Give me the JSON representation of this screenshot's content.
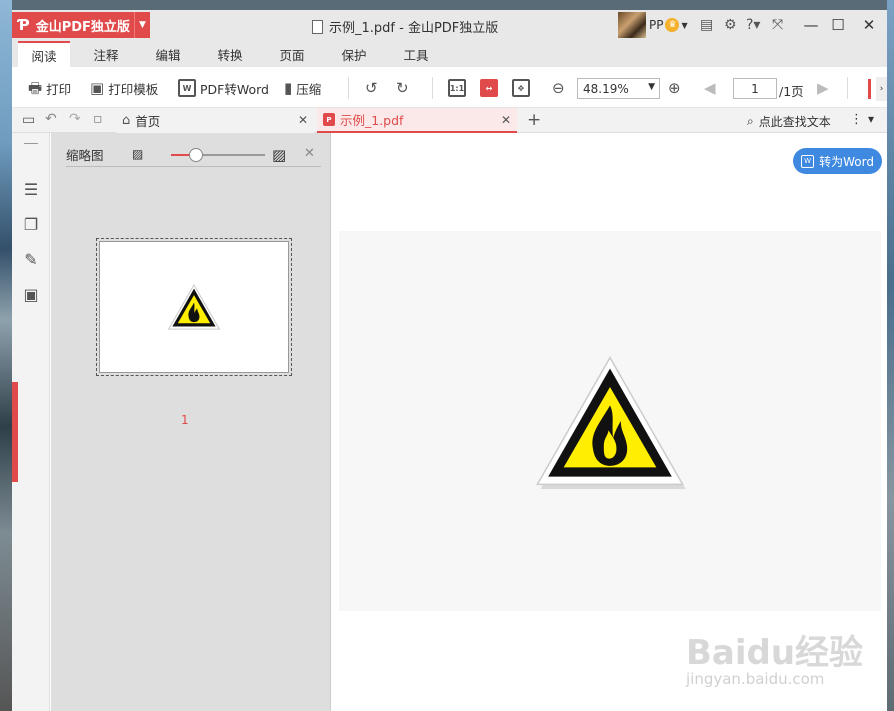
{
  "app": {
    "name": "金山PDF独立版",
    "window_title": "示例_1.pdf - 金山PDF独立版",
    "user_name": "PP"
  },
  "menu": {
    "tabs": [
      {
        "label": "阅读",
        "active": true
      },
      {
        "label": "注释"
      },
      {
        "label": "编辑"
      },
      {
        "label": "转换"
      },
      {
        "label": "页面"
      },
      {
        "label": "保护"
      },
      {
        "label": "工具"
      }
    ]
  },
  "toolbar": {
    "print_label": "打印",
    "print_template_label": "打印模板",
    "pdf_to_word_label": "PDF转Word",
    "compress_label": "压缩",
    "zoom_value": "48.19%",
    "page_current": "1",
    "page_total_label": "/1页",
    "actual_size_label": "1:1"
  },
  "tabs": {
    "home_label": "首页",
    "doc_label": "示例_1.pdf",
    "find_label": "点此查找文本"
  },
  "thumbnail_panel": {
    "title": "缩略图",
    "page_number": "1",
    "slider_level_percent": 27
  },
  "viewer": {
    "to_word_button": "转为Word"
  },
  "watermark": {
    "brand": "Baidu经验",
    "url": "jingyan.baidu.com"
  },
  "colors": {
    "accent": "#e04a4a",
    "button_blue": "#3f8ae0",
    "warning_yellow": "#ffee00"
  },
  "icons": [
    "folder-open-icon",
    "undo-icon",
    "redo-icon",
    "save-icon",
    "home-icon",
    "search-icon",
    "fire-warning-icon"
  ]
}
